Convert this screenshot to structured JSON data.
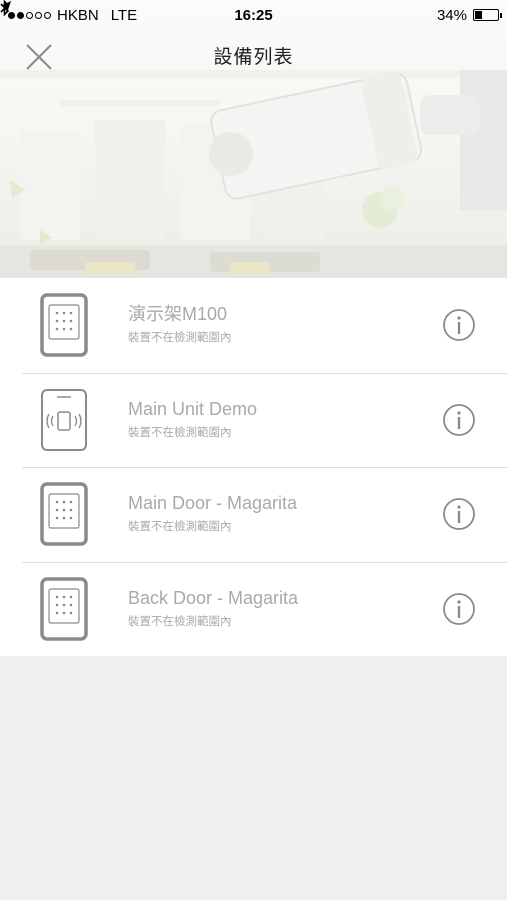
{
  "status_bar": {
    "carrier": "HKBN",
    "network": "LTE",
    "time": "16:25",
    "battery": "34%",
    "battery_level": 0.34
  },
  "nav": {
    "title": "設備列表",
    "close_icon": "close-icon"
  },
  "devices": [
    {
      "name": "演示架M100",
      "status": "裝置不在檢測範圍內",
      "icon": "keypad-device-icon"
    },
    {
      "name": "Main Unit Demo",
      "status": "裝置不在檢測範圍內",
      "icon": "main-unit-device-icon"
    },
    {
      "name": "Main Door - Magarita",
      "status": "裝置不在檢測範圍內",
      "icon": "keypad-device-icon"
    },
    {
      "name": "Back Door - Magarita",
      "status": "裝置不在檢測範圍內",
      "icon": "keypad-device-icon"
    }
  ],
  "colors": {
    "list_background": "#ffffff",
    "page_background": "#efefef",
    "text_muted": "#a9a9a9",
    "icon_stroke": "#8a8a8a"
  }
}
